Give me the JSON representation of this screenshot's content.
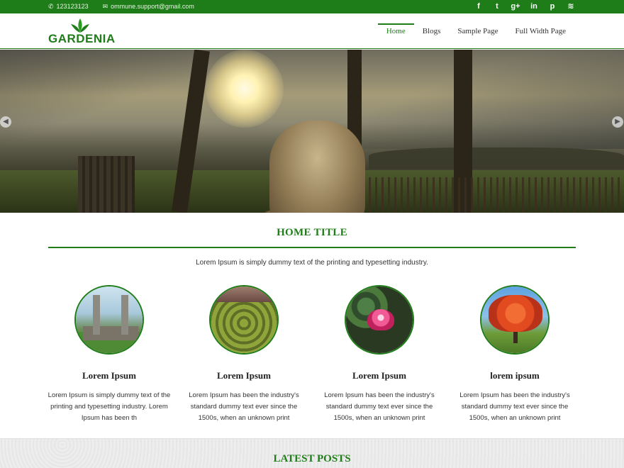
{
  "topbar": {
    "phone": "123123123",
    "email": "ommune.support@gmail.com",
    "social": [
      {
        "icon": "facebook-icon",
        "glyph": "f"
      },
      {
        "icon": "twitter-icon",
        "glyph": "t"
      },
      {
        "icon": "google-plus-icon",
        "glyph": "g+"
      },
      {
        "icon": "linkedin-icon",
        "glyph": "in"
      },
      {
        "icon": "pinterest-icon",
        "glyph": "p"
      },
      {
        "icon": "rss-icon",
        "glyph": "≋"
      }
    ]
  },
  "header": {
    "logo_text": "GARDENIA",
    "nav": [
      {
        "label": "Home",
        "active": true
      },
      {
        "label": "Blogs",
        "active": false
      },
      {
        "label": "Sample Page",
        "active": false
      },
      {
        "label": "Full Width Page",
        "active": false
      }
    ]
  },
  "hero": {
    "prev_icon": "arrow-left-icon",
    "next_icon": "arrow-right-icon"
  },
  "home": {
    "title": "HOME TITLE",
    "intro": "Lorem Ipsum is simply dummy text of the printing and typesetting industry."
  },
  "features": [
    {
      "title": "Lorem Ipsum",
      "text": "Lorem Ipsum is simply dummy text of the printing and typesetting industry. Lorem Ipsum has been th"
    },
    {
      "title": "Lorem Ipsum",
      "text": "Lorem Ipsum has been the industry's standard dummy text ever since the 1500s, when an unknown print"
    },
    {
      "title": "Lorem Ipsum",
      "text": "Lorem Ipsum has been the industry's standard dummy text ever since the 1500s, when an unknown print"
    },
    {
      "title": "lorem ipsum",
      "text": "Lorem Ipsum has been the industry's standard dummy text ever since the 1500s, when an unknown print"
    }
  ],
  "latest": {
    "title": "LATEST POSTS"
  },
  "colors": {
    "brand_green": "#1f7d19"
  }
}
